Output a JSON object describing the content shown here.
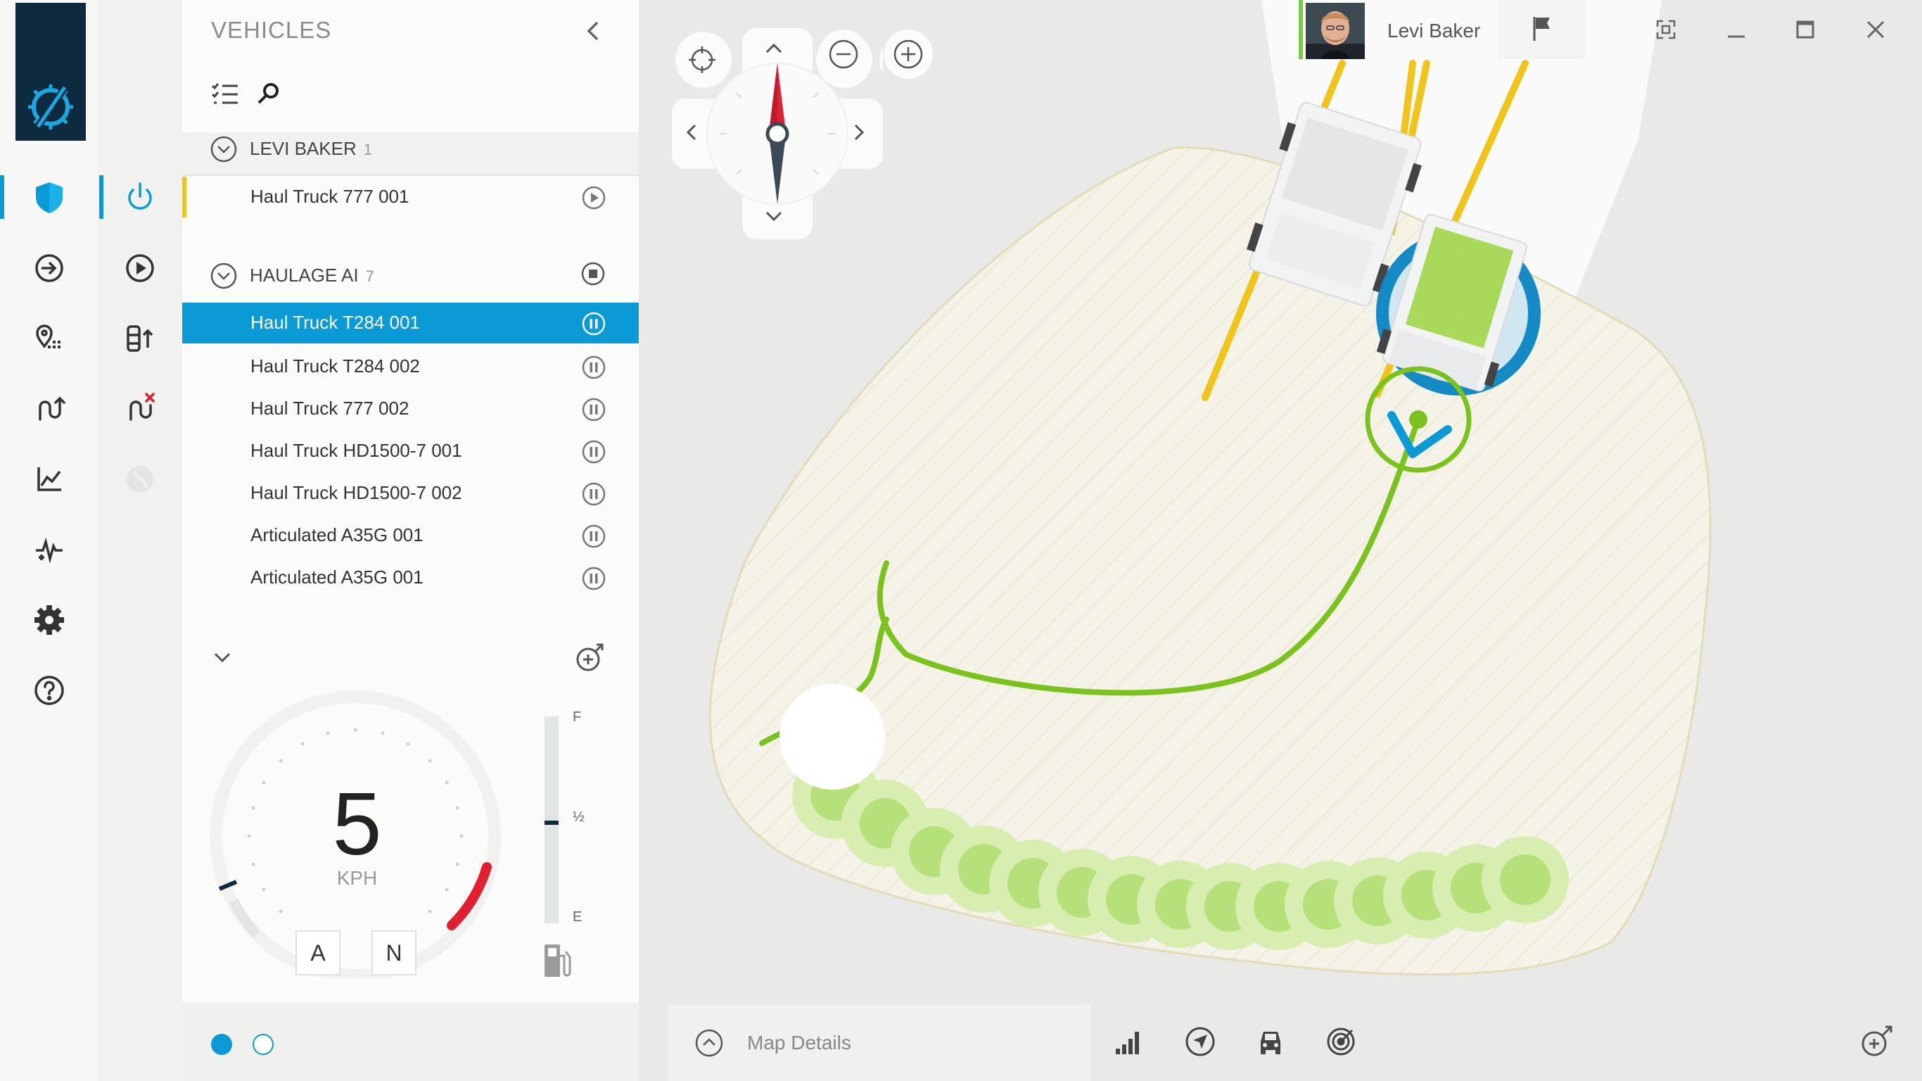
{
  "panel": {
    "title": "VEHICLES",
    "groups": [
      {
        "name": "LEVI BAKER",
        "count": "1",
        "vehicles": [
          {
            "name": "Haul Truck 777 001",
            "action": "play"
          }
        ]
      },
      {
        "name": "HAULAGE AI",
        "count": "7",
        "vehicles": [
          {
            "name": "Haul Truck T284 001",
            "action": "pause",
            "selected": true
          },
          {
            "name": "Haul Truck T284 002",
            "action": "pause"
          },
          {
            "name": "Haul Truck 777 002",
            "action": "pause"
          },
          {
            "name": "Haul Truck HD1500-7 001",
            "action": "pause"
          },
          {
            "name": "Haul Truck HD1500-7 002",
            "action": "pause"
          },
          {
            "name": "Articulated A35G 001",
            "action": "pause"
          },
          {
            "name": "Articulated A35G 001",
            "action": "pause"
          }
        ]
      }
    ]
  },
  "gauge": {
    "speed": "5",
    "unit": "KPH",
    "modes": [
      "A",
      "N"
    ],
    "fuel": {
      "full_label": "F",
      "half_label": "½",
      "empty_label": "E",
      "level_percent": 50
    }
  },
  "user": {
    "name": "Levi Baker"
  },
  "map": {
    "details_label": "Map Details"
  },
  "colors": {
    "accent": "#0a9ad6",
    "navy": "#0e2a3f",
    "path_green": "#7ac31c",
    "lane_yellow": "#f0c419",
    "alert_red": "#e02030"
  }
}
